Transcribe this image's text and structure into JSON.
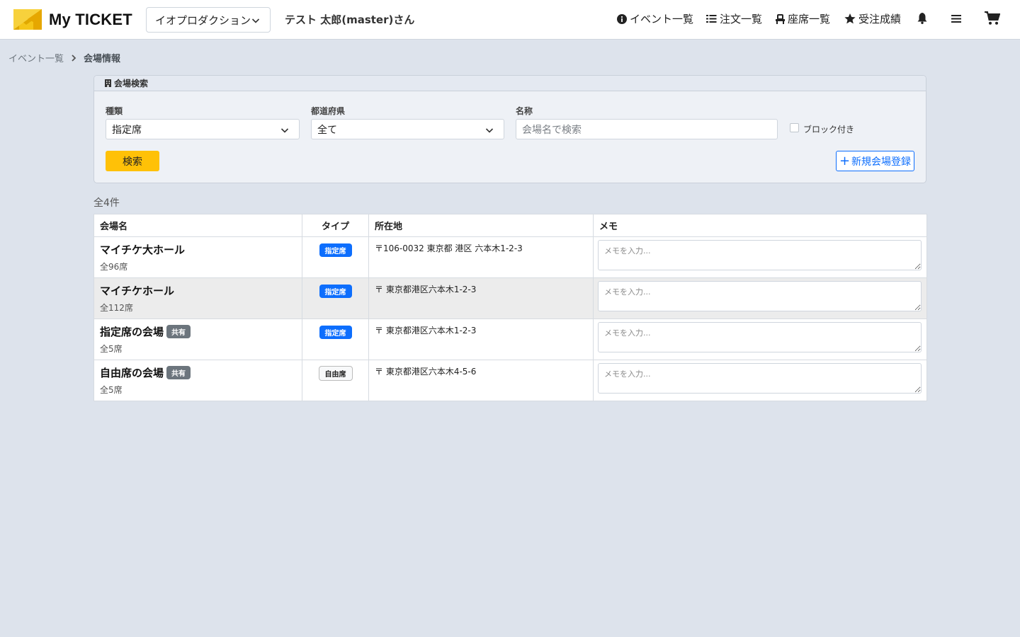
{
  "header": {
    "brand": "My TICKET",
    "organization": "イオプロダクション",
    "user": "テスト 太郎(master)さん",
    "nav": [
      {
        "label": "イベント一覧",
        "icon": "info-circle-icon"
      },
      {
        "label": "注文一覧",
        "icon": "list-icon"
      },
      {
        "label": "座席一覧",
        "icon": "chair-icon"
      },
      {
        "label": "受注成績",
        "icon": "star-icon"
      }
    ],
    "icons": [
      "bell-icon",
      "menu-icon",
      "cart-icon"
    ],
    "brand_colors": {
      "yellow": "#f5c518",
      "accent": "#0d6efd"
    }
  },
  "breadcrumb": {
    "parent": "イベント一覧",
    "current": "会場情報"
  },
  "search": {
    "title": "会場検索",
    "type_label": "種類",
    "type_value": "指定席",
    "pref_label": "都道府県",
    "pref_value": "全て",
    "name_label": "名称",
    "name_placeholder": "会場名で検索",
    "block_label": "ブロック付き",
    "search_button": "検索",
    "new_button": "新規会場登録"
  },
  "result": {
    "count": "全4件",
    "columns": [
      "会場名",
      "タイプ",
      "所在地",
      "メモ"
    ],
    "memo_placeholder": "メモを入力...",
    "rows": [
      {
        "name": "マイチケ大ホール",
        "shared": "",
        "seats": "全96席",
        "type": "指定席",
        "type_kind": "reserved",
        "address": "〒106-0032 東京都 港区 六本木1-2-3"
      },
      {
        "name": "マイチケホール",
        "shared": "",
        "seats": "全112席",
        "type": "指定席",
        "type_kind": "reserved",
        "address": "〒 東京都港区六本木1-2-3"
      },
      {
        "name": "指定席の会場",
        "shared": "共有",
        "seats": "全5席",
        "type": "指定席",
        "type_kind": "reserved",
        "address": "〒 東京都港区六本木1-2-3"
      },
      {
        "name": "自由席の会場",
        "shared": "共有",
        "seats": "全5席",
        "type": "自由席",
        "type_kind": "free",
        "address": "〒 東京都港区六本木4-5-6"
      }
    ]
  }
}
